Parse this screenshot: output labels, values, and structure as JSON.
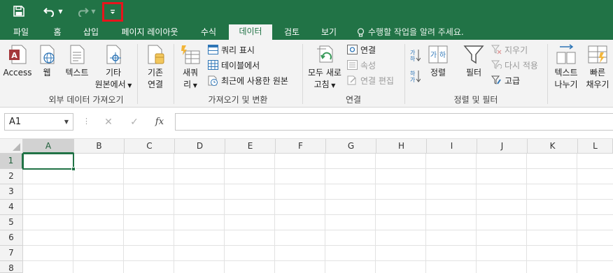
{
  "quick_access": {
    "save_icon": "save-icon",
    "undo_icon": "undo-icon",
    "redo_icon": "redo-icon",
    "customize_icon": "customize-dropdown-icon"
  },
  "tabs": [
    "파일",
    "홈",
    "삽입",
    "페이지 레이아웃",
    "수식",
    "데이터",
    "검토",
    "보기"
  ],
  "active_tab": "데이터",
  "tell_me": "수행할 작업을 알려 주세요.",
  "ribbon": {
    "get_external": {
      "access": "Access",
      "web": "웹",
      "text": "텍스트",
      "other_line1": "기타",
      "other_line2": "원본에서",
      "existing_line1": "기존",
      "existing_line2": "연결",
      "group_label": "외부 데이터 가져오기"
    },
    "get_transform": {
      "new_query_line1": "새쿼",
      "new_query_line2": "리",
      "show_queries": "쿼리 표시",
      "from_table": "테이블에서",
      "recent_sources": "최근에 사용한 원본",
      "group_label": "가져오기 및 변환"
    },
    "connections": {
      "refresh_line1": "모두 새로",
      "refresh_line2": "고침",
      "connections": "연결",
      "properties": "속성",
      "edit_links": "연결 편집",
      "group_label": "연결"
    },
    "sort_filter": {
      "sort": "정렬",
      "filter": "필터",
      "clear": "지우기",
      "reapply": "다시 적용",
      "advanced": "고급",
      "group_label": "정렬 및 필터"
    },
    "data_tools": {
      "text_to_columns_line1": "텍스트",
      "text_to_columns_line2": "나누기",
      "flash_fill_line1": "빠른",
      "flash_fill_line2": "채우기"
    }
  },
  "formula_bar": {
    "name_box": "A1",
    "fx": "fx",
    "cancel": "✕",
    "enter": "✓",
    "value": ""
  },
  "columns": [
    "A",
    "B",
    "C",
    "D",
    "E",
    "F",
    "G",
    "H",
    "I",
    "J",
    "K",
    "L"
  ],
  "rows": [
    "1",
    "2",
    "3",
    "4",
    "5",
    "6",
    "7",
    "8"
  ],
  "colors": {
    "brand": "#217346",
    "highlight": "#e8141c"
  }
}
